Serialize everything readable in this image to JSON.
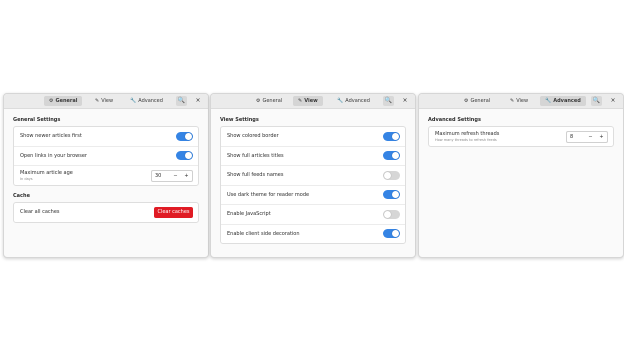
{
  "tabs": [
    {
      "label": "General",
      "icon": "gear-icon",
      "glyph": "⚙"
    },
    {
      "label": "View",
      "icon": "brush-icon",
      "glyph": "✎"
    },
    {
      "label": "Advanced",
      "icon": "wrench-icon",
      "glyph": "🔧"
    }
  ],
  "search_glyph": "🔍",
  "close_glyph": "×",
  "windows": {
    "general": {
      "section1": "General Settings",
      "rows": [
        {
          "label": "Show newer articles first",
          "on": true
        },
        {
          "label": "Open links in your browser",
          "on": true
        }
      ],
      "age": {
        "label": "Maximum article age",
        "sublabel": "In days",
        "value": "30",
        "minus": "−",
        "plus": "+"
      },
      "section2": "Cache",
      "cache": {
        "label": "Clear all caches",
        "button": "Clear caches"
      }
    },
    "view": {
      "section": "View Settings",
      "rows": [
        {
          "label": "Show colored border",
          "on": true
        },
        {
          "label": "Show full articles titles",
          "on": true
        },
        {
          "label": "Show full feeds names",
          "on": false
        },
        {
          "label": "Use dark theme for reader mode",
          "on": true
        },
        {
          "label": "Enable JavaScript",
          "on": false
        },
        {
          "label": "Enable client side decoration",
          "on": true
        }
      ]
    },
    "advanced": {
      "section": "Advanced Settings",
      "threads": {
        "label": "Maximum refresh threads",
        "sublabel": "How many threads to refresh feeds",
        "value": "8",
        "minus": "−",
        "plus": "+"
      }
    }
  },
  "colors": {
    "accent": "#3584e4",
    "danger": "#e01b24",
    "headerbar": "#ebebeb",
    "window": "#fafafa"
  }
}
